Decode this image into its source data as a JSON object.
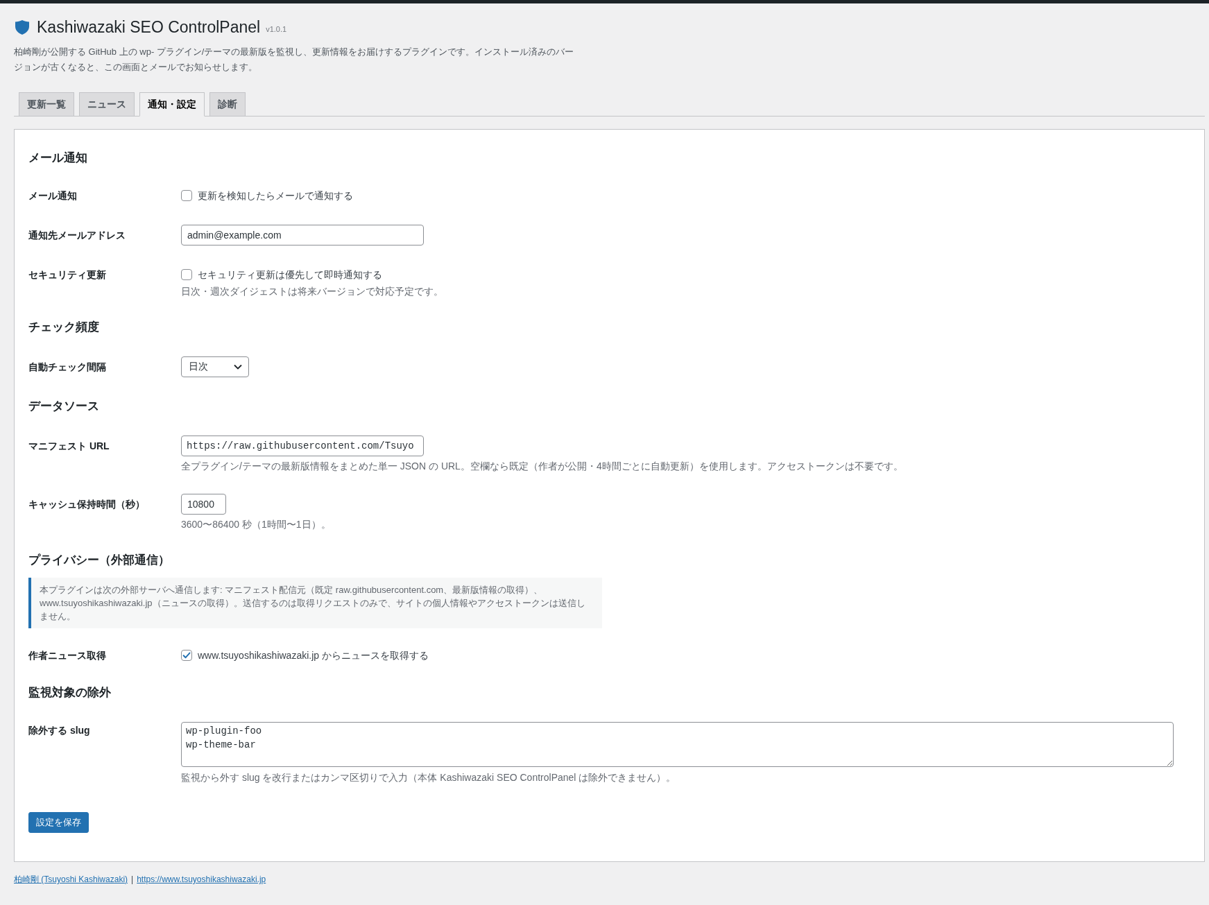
{
  "header": {
    "title": "Kashiwazaki SEO ControlPanel",
    "version": "v1.0.1",
    "description": "柏崎剛が公開する GitHub 上の wp- プラグイン/テーマの最新版を監視し、更新情報をお届けするプラグインです。インストール済みのバージョンが古くなると、この画面とメールでお知らせします。"
  },
  "tabs": [
    {
      "label": "更新一覧",
      "selected": false
    },
    {
      "label": "ニュース",
      "selected": false
    },
    {
      "label": "通知・設定",
      "selected": true
    },
    {
      "label": "診断",
      "selected": false
    }
  ],
  "sections": [
    {
      "heading": "メール通知",
      "rows": [
        {
          "kind": "checkbox",
          "label": "メール通知",
          "checked": false,
          "text": "更新を検知したらメールで通知する"
        },
        {
          "kind": "text",
          "label": "通知先メールアドレス",
          "value": "admin@example.com"
        },
        {
          "kind": "checkbox",
          "label": "セキュリティ更新",
          "checked": false,
          "text": "セキュリティ更新は優先して即時通知する",
          "description": "日次・週次ダイジェストは将来バージョンで対応予定です。"
        }
      ]
    },
    {
      "heading": "チェック頻度",
      "rows": [
        {
          "kind": "select",
          "label": "自動チェック間隔",
          "value": "日次"
        }
      ]
    },
    {
      "heading": "データソース",
      "rows": [
        {
          "kind": "url",
          "label": "マニフェスト URL",
          "value": "https://raw.githubusercontent.com/Tsuyo",
          "description": "全プラグイン/テーマの最新版情報をまとめた単一 JSON の URL。空欄なら既定（作者が公開・4時間ごとに自動更新）を使用します。アクセストークンは不要です。"
        },
        {
          "kind": "number",
          "label": "キャッシュ保持時間（秒）",
          "value": "10800",
          "description": "3600〜86400 秒（1時間〜1日）。"
        }
      ]
    },
    {
      "heading": "プライバシー（外部通信）",
      "notice": "本プラグインは次の外部サーバへ通信します: マニフェスト配信元（既定 raw.githubusercontent.com、最新版情報の取得）、www.tsuyoshikashiwazaki.jp（ニュースの取得）。送信するのは取得リクエストのみで、サイトの個人情報やアクセストークンは送信しません。",
      "rows": [
        {
          "kind": "checkbox",
          "label": "作者ニュース取得",
          "checked": true,
          "text": "www.tsuyoshikashiwazaki.jp からニュースを取得する"
        }
      ]
    },
    {
      "heading": "監視対象の除外",
      "rows": [
        {
          "kind": "textarea",
          "label": "除外する slug",
          "value": "wp-plugin-foo\nwp-theme-bar",
          "description": "監視から外す slug を改行またはカンマ区切りで入力（本体 Kashiwazaki SEO ControlPanel は除外できません）。"
        }
      ]
    }
  ],
  "save_button": "設定を保存",
  "footer": {
    "links": [
      "柏崎剛 (Tsuyoshi Kashiwazaki)",
      "https://www.tsuyoshikashiwazaki.jp"
    ],
    "separator": "|"
  }
}
